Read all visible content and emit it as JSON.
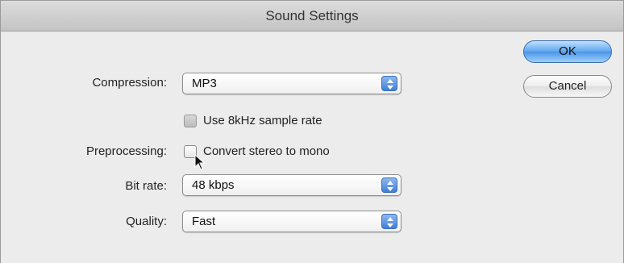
{
  "window": {
    "title": "Sound Settings"
  },
  "buttons": {
    "ok": "OK",
    "cancel": "Cancel"
  },
  "form": {
    "compression": {
      "label": "Compression:",
      "value": "MP3"
    },
    "use_8khz": {
      "label": "Use 8kHz sample rate",
      "checked": false,
      "enabled": false
    },
    "preprocessing": {
      "label": "Preprocessing:",
      "checkbox_label": "Convert stereo to mono",
      "checked": false
    },
    "bit_rate": {
      "label": "Bit rate:",
      "value": "48 kbps"
    },
    "quality": {
      "label": "Quality:",
      "value": "Fast"
    }
  },
  "colors": {
    "default_button": "#5ea6ee",
    "popup_arrows": "#3f7fd6"
  },
  "icons": {
    "popup_arrows": "up-down-arrows-icon",
    "cursor": "mouse-pointer-icon"
  }
}
